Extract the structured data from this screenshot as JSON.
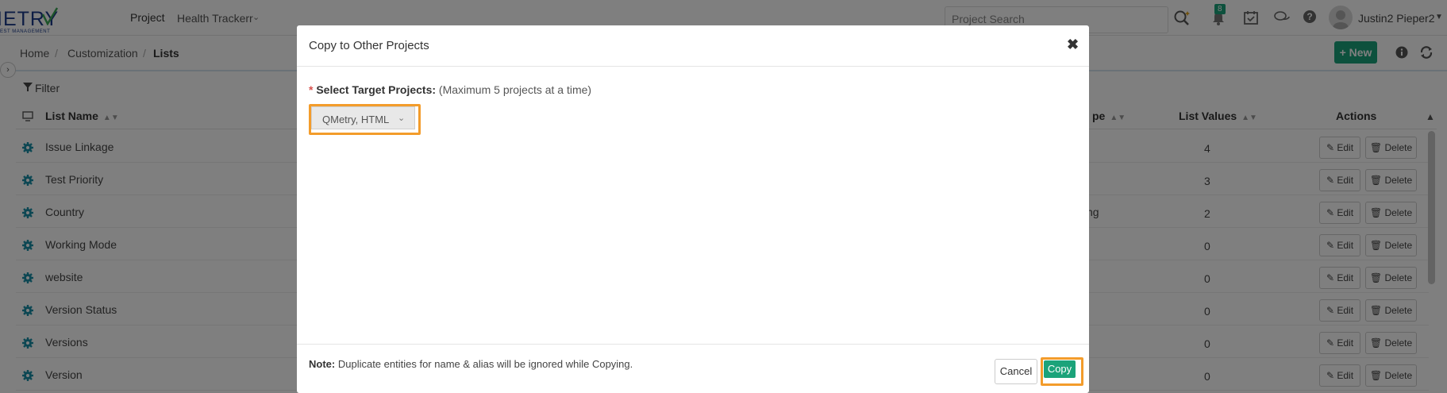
{
  "brand": {
    "logo_text": "IETRY",
    "logo_sub": "EST MANAGEMENT"
  },
  "topbar": {
    "project_label": "Project",
    "project_name": "Health Trackerr",
    "search_placeholder": "Project Search",
    "notification_count": "8",
    "user_name": "Justin2 Pieper2"
  },
  "breadcrumb": {
    "home": "Home",
    "customization": "Customization",
    "current": "Lists"
  },
  "toolbar": {
    "new_label": "+ New"
  },
  "filter": {
    "label": "Filter"
  },
  "table": {
    "headers": {
      "list_name": "List Name",
      "type_partial": "pe",
      "list_values": "List Values",
      "actions": "Actions"
    },
    "rows": [
      {
        "name": "Issue Linkage",
        "type": "",
        "values": "4"
      },
      {
        "name": "Test Priority",
        "type": "",
        "values": "3"
      },
      {
        "name": "Country",
        "type": "ng",
        "values": "2"
      },
      {
        "name": "Working Mode",
        "type": "",
        "values": "0"
      },
      {
        "name": "website",
        "type": "",
        "values": "0"
      },
      {
        "name": "Version Status",
        "type": "",
        "values": "0"
      },
      {
        "name": "Versions",
        "type": "",
        "values": "0"
      },
      {
        "name": "Version",
        "type": "",
        "values": "0"
      }
    ],
    "edit_label": "Edit",
    "delete_label": "Delete"
  },
  "modal": {
    "title": "Copy to Other Projects",
    "required_mark": "*",
    "field_label": "Select Target Projects:",
    "field_hint": "(Maximum 5 projects at a time)",
    "selected_value": "QMetry, HTML",
    "note_label": "Note:",
    "note_text": "Duplicate entities for name & alias will be ignored while Copying.",
    "cancel_label": "Cancel",
    "copy_label": "Copy"
  },
  "colors": {
    "accent": "#1ba37a",
    "highlight": "#f39c2b",
    "brand": "#1b3a8a"
  }
}
